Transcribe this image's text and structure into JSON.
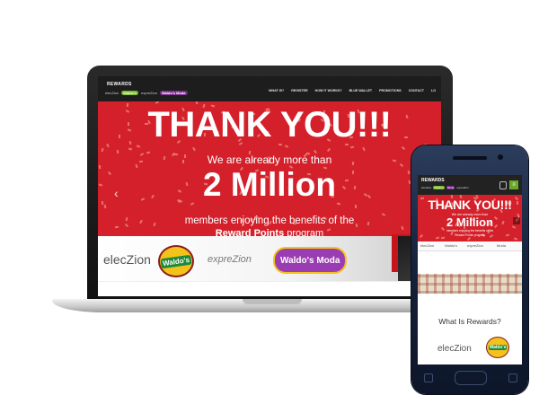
{
  "desktop": {
    "nav": {
      "brand": "REWARDS",
      "logos": [
        "elecZion",
        "Waldo's",
        "expreZion",
        "Waldo's Moda"
      ],
      "menu": [
        "WHAT IS?",
        "REGISTER",
        "HOW IT WORKS?",
        "BLUE WALLET",
        "PROMOTIONS",
        "CONTACT"
      ],
      "user_label": "LO"
    },
    "hero": {
      "title": "THANK YOU!!!",
      "line1": "We are already more than",
      "big": "2 Million",
      "line2": "members enjoying the benefits of the",
      "line3_bold": "Reward Points",
      "line3_rest": " program",
      "arrow": "‹"
    },
    "strip": {
      "elec": "elecZion",
      "waldos": "Waldo's",
      "expre": "expreZion",
      "moda": "Waldo's Moda"
    }
  },
  "mobile": {
    "nav": {
      "brand": "REWARDS",
      "logos": [
        "elecZion",
        "Waldo's",
        "Moda",
        "expreZion"
      ],
      "menu_icon": "≡"
    },
    "hero": {
      "title": "THANK YOU!!!",
      "line1": "We are already more than",
      "big": "2 Million",
      "line2": "members enjoying the benefits of the",
      "line3": "Reward Points program",
      "arrow": "›"
    },
    "strip": [
      "elecZion",
      "Waldo's",
      "expreZion",
      "Moda"
    ],
    "what_is": "What Is Rewards?",
    "elec": "elecZion",
    "waldos": "Waldo's"
  },
  "colors": {
    "hero_red": "#d4202a",
    "nav_dark": "#1d1d1d",
    "waldos_green": "#1d8a3a",
    "waldos_yellow": "#f3c21b",
    "moda_purple": "#9a3db2"
  }
}
